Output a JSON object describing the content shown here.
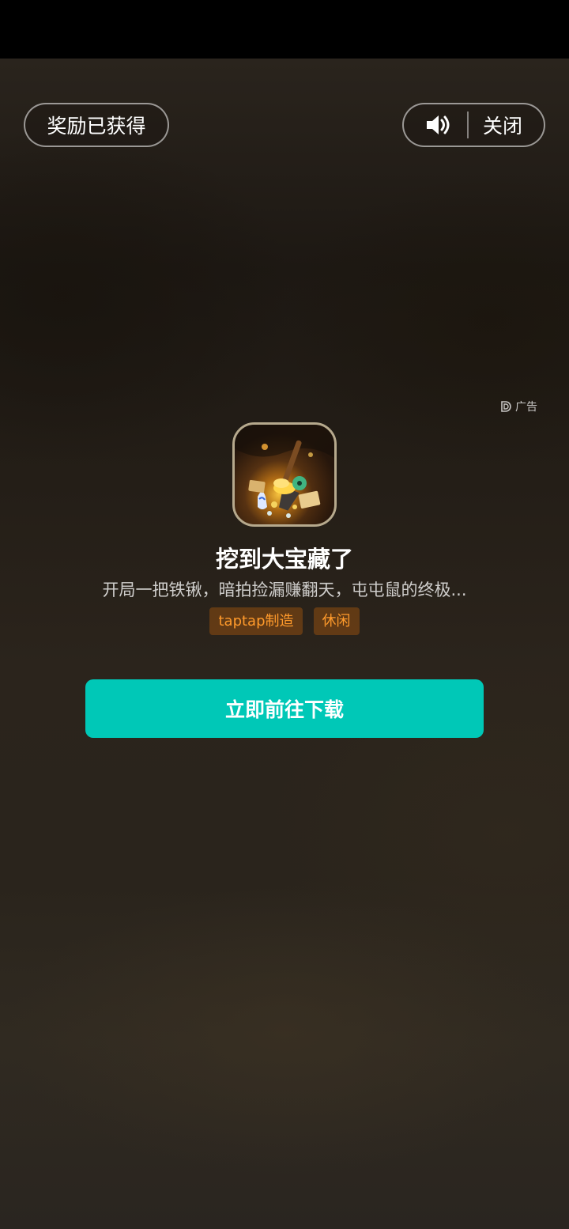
{
  "status_bar": {
    "icons": []
  },
  "header": {
    "reward_label": "奖励已获得",
    "sound_icon": "speaker-volume-icon",
    "close_label": "关闭"
  },
  "ad": {
    "badge_icon": "ad-logo-icon",
    "badge_label": "广告",
    "app_icon": "treasure-game-icon",
    "title": "挖到大宝藏了",
    "description": "开局一把铁锹，暗拍捡漏赚翻天，屯屯鼠的终极...",
    "tags": [
      "taptap制造",
      "休闲"
    ],
    "cta_label": "立即前往下载"
  },
  "colors": {
    "accent": "#00c8b7",
    "tag_text": "#ff9a2b",
    "tag_bg": "#7a4314"
  }
}
